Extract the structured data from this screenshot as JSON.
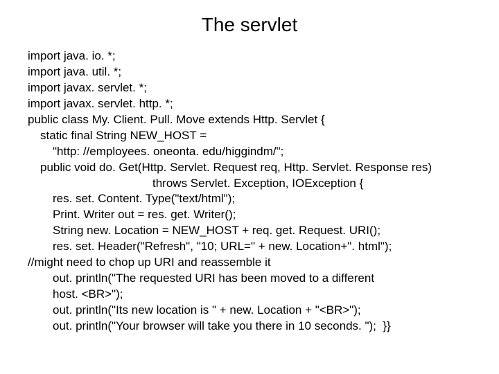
{
  "title": "The servlet",
  "lines": [
    {
      "text": "import java. io. *;",
      "indent": ""
    },
    {
      "text": "import java. util. *;",
      "indent": ""
    },
    {
      "text": "import javax. servlet. *;",
      "indent": ""
    },
    {
      "text": "import javax. servlet. http. *;",
      "indent": ""
    },
    {
      "text": "public class My. Client. Pull. Move extends Http. Servlet {",
      "indent": ""
    },
    {
      "text": "static final String NEW_HOST =",
      "indent": "indent-1"
    },
    {
      "text": "\"http: //employees. oneonta. edu/higgindm/\";",
      "indent": "indent-2"
    },
    {
      "text": "public void do. Get(Http. Servlet. Request req, Http. Servlet. Response res)",
      "indent": "indent-1"
    },
    {
      "text": "throws Servlet. Exception, IOException {",
      "indent": "indent-center"
    },
    {
      "text": "res. set. Content. Type(\"text/html\");",
      "indent": "indent-2"
    },
    {
      "text": "Print. Writer out = res. get. Writer();",
      "indent": "indent-2"
    },
    {
      "text": "String new. Location = NEW_HOST + req. get. Request. URI();",
      "indent": "indent-2"
    },
    {
      "text": "",
      "indent": "",
      "blank": true
    },
    {
      "text": "res. set. Header(\"Refresh\", \"10; URL=\" + new. Location+\". html\");",
      "indent": "indent-2"
    },
    {
      "text": "//might need to chop up URI and reassemble it",
      "indent": ""
    },
    {
      "text": "out. println(\"The requested URI has been moved to a different",
      "indent": "indent-2"
    },
    {
      "text": "host. <BR>\");",
      "indent": "indent-2"
    },
    {
      "text": "out. println(\"Its new location is \" + new. Location + \"<BR>\");",
      "indent": "indent-2"
    },
    {
      "text": "out. println(\"Your browser will take you there in 10 seconds. \");  }}",
      "indent": "indent-2"
    }
  ]
}
